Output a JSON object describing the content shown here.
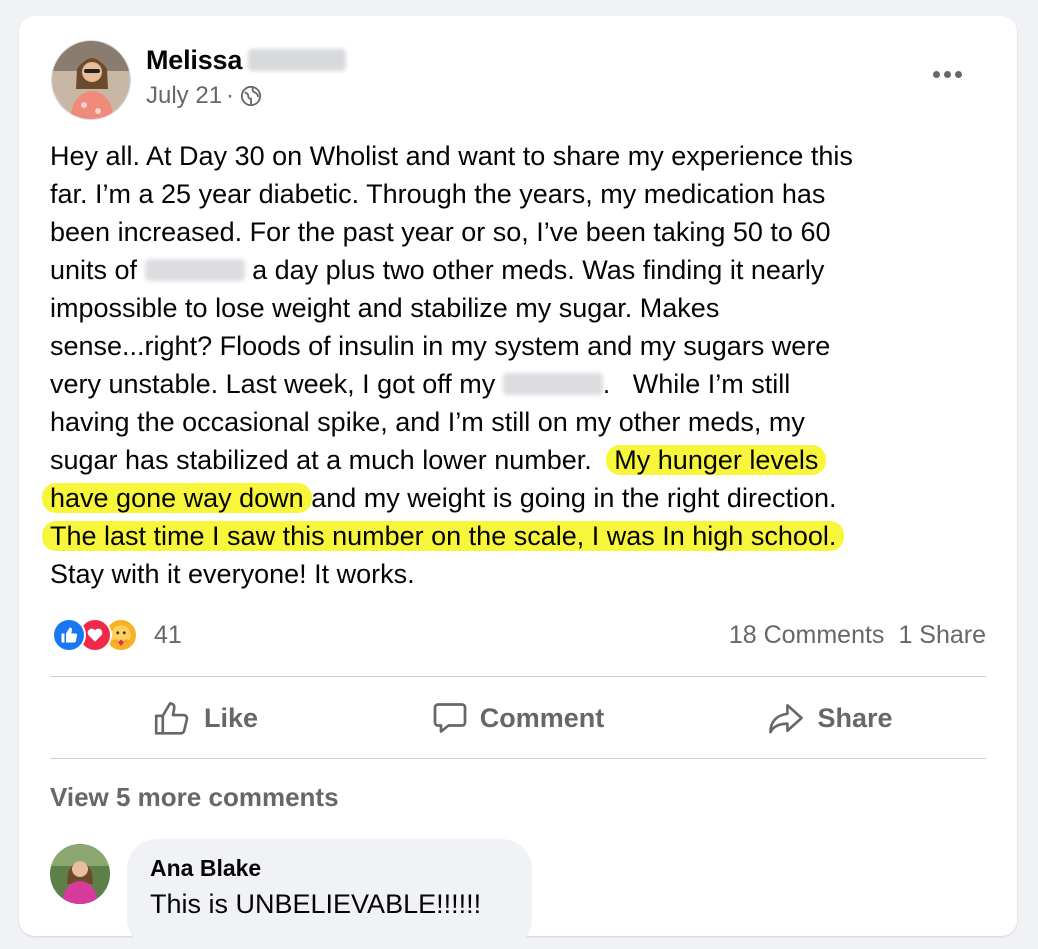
{
  "post": {
    "author_first": "Melissa",
    "date": "July 21",
    "privacy_icon": "globe-icon",
    "more_icon": "more-options-icon",
    "body_lines": [
      "Hey all.   At Day 30 on Wholist and want to share my experience this",
      "far.   I’m a 25 year diabetic.   Through the years, my medication has",
      "been increased.   For the past year or so, I’ve been taking 50 to 60",
      "a day plus two other meds.    Was finding it nearly",
      "impossible to lose weight and stabilize my sugar.   Makes",
      "sense...right?   Floods of insulin in my system and my sugars were",
      "very unstable.   Last week, I got off my",
      "While I’m still",
      "having the occasional spike, and I’m still on my other meds, my",
      "sugar has stabilized at a much lower number.",
      "My hunger levels",
      "have gone way down",
      "and my weight is going in the right direction.",
      "The last time I saw this number on the scale, I was In high school.",
      "Stay with it everyone!   It works."
    ],
    "units_prefix": "units of"
  },
  "stats": {
    "reaction_count": "41",
    "comments": "18 Comments",
    "shares": "1 Share"
  },
  "actions": {
    "like": "Like",
    "comment": "Comment",
    "share": "Share"
  },
  "comments": {
    "view_more": "View 5 more comments",
    "first": {
      "name": "Ana Blake",
      "text": "This is UNBELIEVABLE!!!!!!"
    }
  },
  "colors": {
    "highlight": "#f8f63b",
    "like_blue": "#1877f2",
    "love_red": "#f02849",
    "care_yellow": "#f7b125"
  }
}
